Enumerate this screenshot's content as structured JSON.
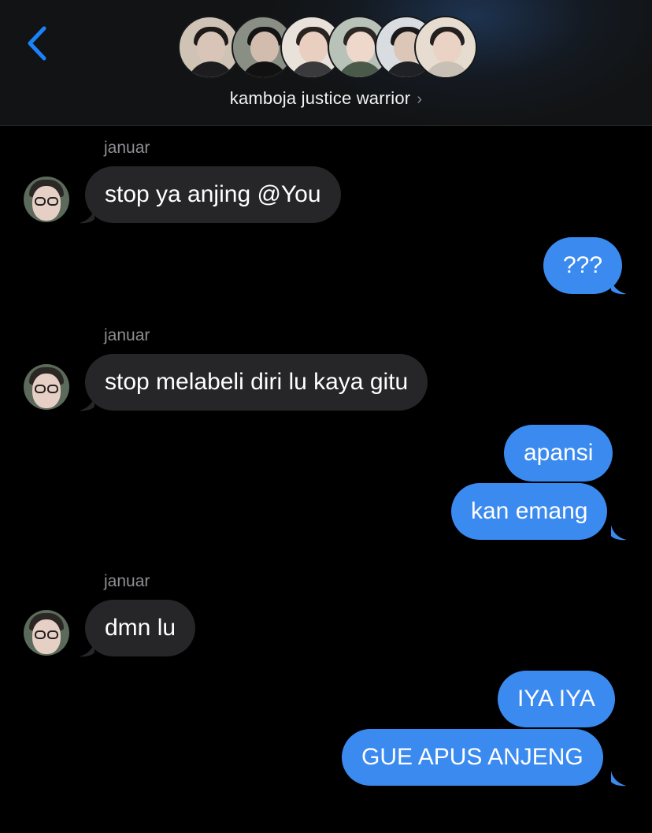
{
  "header": {
    "group_name": "kamboja justice warrior",
    "chevron": "›",
    "accent_color": "#1a82fb",
    "group_avatars": [
      {
        "name": "member-1"
      },
      {
        "name": "member-2"
      },
      {
        "name": "member-3"
      },
      {
        "name": "member-4"
      },
      {
        "name": "member-5"
      },
      {
        "name": "member-6"
      }
    ]
  },
  "messages": [
    {
      "direction": "incoming",
      "sender": "januar",
      "text": "stop ya anjing @You"
    },
    {
      "direction": "outgoing",
      "text": "???"
    },
    {
      "direction": "incoming",
      "sender": "januar",
      "text": "stop melabeli diri lu kaya gitu"
    },
    {
      "direction": "outgoing",
      "text": "apansi"
    },
    {
      "direction": "outgoing",
      "text": "kan emang"
    },
    {
      "direction": "incoming",
      "sender": "januar",
      "text": "dmn lu"
    },
    {
      "direction": "outgoing",
      "text": "IYA IYA"
    },
    {
      "direction": "outgoing",
      "text": "GUE APUS ANJENG"
    }
  ],
  "colors": {
    "incoming_bubble": "#262628",
    "outgoing_bubble": "#3b8af0",
    "sender_label": "#8e8e93"
  }
}
